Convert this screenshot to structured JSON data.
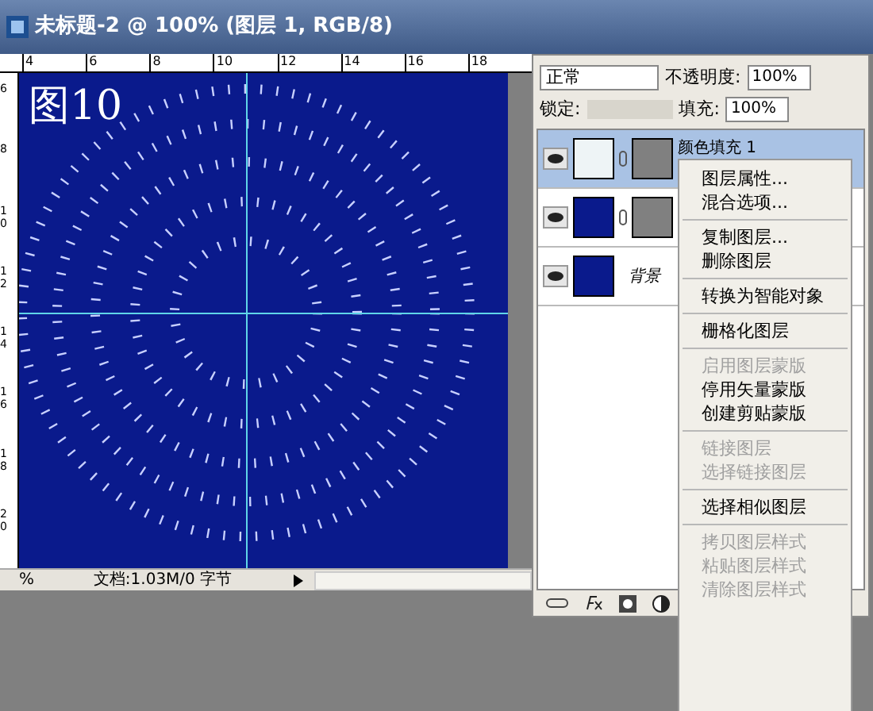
{
  "window": {
    "title": "未标题-2 @ 100% (图层 1, RGB/8)"
  },
  "top_ruler": [
    "4",
    "6",
    "8",
    "10",
    "12",
    "14",
    "16",
    "18"
  ],
  "left_ruler": [
    "6",
    "8",
    "10",
    "12",
    "14",
    "16",
    "18",
    "20"
  ],
  "canvas": {
    "caption": "图10"
  },
  "status_bar": {
    "zoom": "%",
    "document": "文档:1.03M/0 字节"
  },
  "layers_panel": {
    "blend_mode": "正常",
    "opacity_label": "不透明度:",
    "opacity": "100%",
    "lock_label": "锁定:",
    "fill_label": "填充:",
    "fill": "100%",
    "layers": [
      {
        "kind": "fill",
        "name": "颜色填充 1",
        "selected": true,
        "visible": true
      },
      {
        "kind": "fill",
        "selected": false,
        "visible": true
      },
      {
        "kind": "background",
        "name": "背景",
        "selected": false,
        "visible": true
      }
    ]
  },
  "context_menu": [
    {
      "kind": "item",
      "label": "图层属性...",
      "disabled": false
    },
    {
      "kind": "item",
      "label": "混合选项...",
      "disabled": false
    },
    {
      "kind": "separator"
    },
    {
      "kind": "item",
      "label": "复制图层...",
      "disabled": false
    },
    {
      "kind": "item",
      "label": "删除图层",
      "disabled": false
    },
    {
      "kind": "separator"
    },
    {
      "kind": "item",
      "label": "转换为智能对象",
      "disabled": false
    },
    {
      "kind": "separator"
    },
    {
      "kind": "item",
      "label": "栅格化图层",
      "disabled": false
    },
    {
      "kind": "separator"
    },
    {
      "kind": "item",
      "label": "启用图层蒙版",
      "disabled": true
    },
    {
      "kind": "item",
      "label": "停用矢量蒙版",
      "disabled": false
    },
    {
      "kind": "item",
      "label": "创建剪贴蒙版",
      "disabled": false
    },
    {
      "kind": "separator"
    },
    {
      "kind": "item",
      "label": "链接图层",
      "disabled": true
    },
    {
      "kind": "item",
      "label": "选择链接图层",
      "disabled": true
    },
    {
      "kind": "separator"
    },
    {
      "kind": "item",
      "label": "选择相似图层",
      "disabled": false
    },
    {
      "kind": "separator"
    },
    {
      "kind": "item",
      "label": "拷贝图层样式",
      "disabled": true
    },
    {
      "kind": "item",
      "label": "粘贴图层样式",
      "disabled": true
    },
    {
      "kind": "item",
      "label": "清除图层样式",
      "disabled": true
    }
  ]
}
